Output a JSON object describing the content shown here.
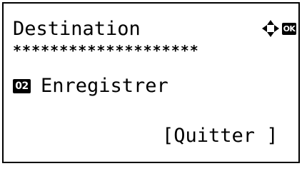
{
  "screen": {
    "title": "Destination",
    "nav_icon": "four-way-arrows-icon",
    "ok_label": "OK",
    "stars": "********************",
    "entry": {
      "number": "02",
      "label": "Enregistrer"
    },
    "quit_label": "[Quitter ]"
  }
}
